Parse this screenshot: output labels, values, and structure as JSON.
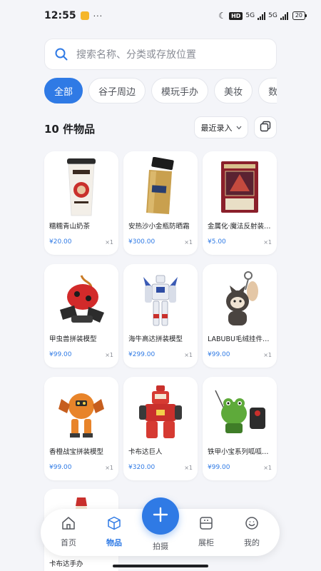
{
  "status": {
    "time": "12:55",
    "dots": "···",
    "hd": "HD",
    "net1": "5G",
    "net2": "5G",
    "battery": "20"
  },
  "search": {
    "placeholder": "搜索名称、分类或存放位置"
  },
  "categories": [
    "全部",
    "谷子周边",
    "模玩手办",
    "美妆",
    "数码电子"
  ],
  "summary": {
    "count": "10 件物品",
    "sort": "最近录入"
  },
  "items": [
    {
      "name": "糯糯青山奶茶",
      "price": "¥20.00",
      "qty": "×1",
      "icon": "milk-tea-cup-image"
    },
    {
      "name": "安热沙小金瓶防晒霜",
      "price": "¥300.00",
      "qty": "×1",
      "icon": "sunscreen-bottle-image"
    },
    {
      "name": "金属化·魔法反射装甲 游戏王卡",
      "price": "¥5.00",
      "qty": "×1",
      "icon": "trading-card-image"
    },
    {
      "name": "甲虫兽拼装模型",
      "price": "¥99.00",
      "qty": "×1",
      "icon": "beetle-model-image"
    },
    {
      "name": "海牛高达拼装模型",
      "price": "¥299.00",
      "qty": "×1",
      "icon": "gundam-model-image"
    },
    {
      "name": "LABUBU毛绒挂件公仔",
      "price": "¥99.00",
      "qty": "×1",
      "icon": "labubu-plush-image"
    },
    {
      "name": "香橙战宝拼装模型",
      "price": "¥99.00",
      "qty": "×1",
      "icon": "orange-mech-image"
    },
    {
      "name": "卡布达巨人",
      "price": "¥320.00",
      "qty": "×1",
      "icon": "kabuda-robot-image"
    },
    {
      "name": "铁甲小宝系列呱呱蛙模型",
      "price": "¥99.00",
      "qty": "×1",
      "icon": "frog-robot-image"
    },
    {
      "name": "卡布达手办",
      "price": "",
      "qty": "",
      "icon": "red-figure-image"
    }
  ],
  "tabs": [
    {
      "label": "首页",
      "icon": "home-icon"
    },
    {
      "label": "物品",
      "icon": "cube-icon"
    },
    {
      "label": "拍摄",
      "icon": "plus-icon"
    },
    {
      "label": "展柜",
      "icon": "cabinet-icon"
    },
    {
      "label": "我的",
      "icon": "smile-face-icon"
    }
  ],
  "colors": {
    "accent": "#2f7ae5",
    "background": "#f4f5f9",
    "card": "#ffffff"
  }
}
